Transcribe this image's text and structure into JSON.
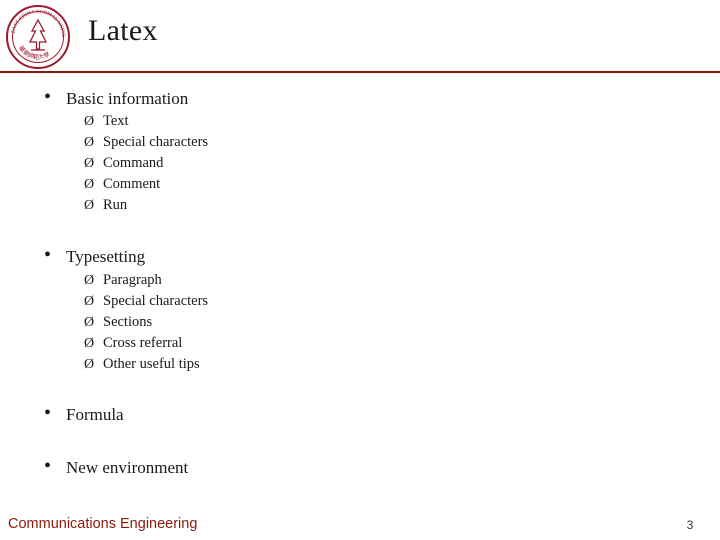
{
  "header": {
    "title": "Latex",
    "logo_alt": "university-seal-logo"
  },
  "outline": [
    {
      "label": "Basic information",
      "children": [
        "Text",
        "Special characters",
        "Command",
        "Comment",
        "Run"
      ]
    },
    {
      "label": "Typesetting",
      "children": [
        "Paragraph",
        "Special characters",
        "Sections",
        "Cross referral",
        "Other useful tips"
      ]
    },
    {
      "label": "Formula",
      "children": []
    },
    {
      "label": "New environment",
      "children": []
    }
  ],
  "bullets": {
    "level1": "•",
    "level2": "Ø"
  },
  "footer": {
    "organization": "Communications Engineering",
    "page_number": "3"
  },
  "colors": {
    "accent_rule": "#8B1A0A",
    "footer_text": "#8B1A0A",
    "logo": "#9B1B30",
    "body_text": "#1a1a1a"
  }
}
